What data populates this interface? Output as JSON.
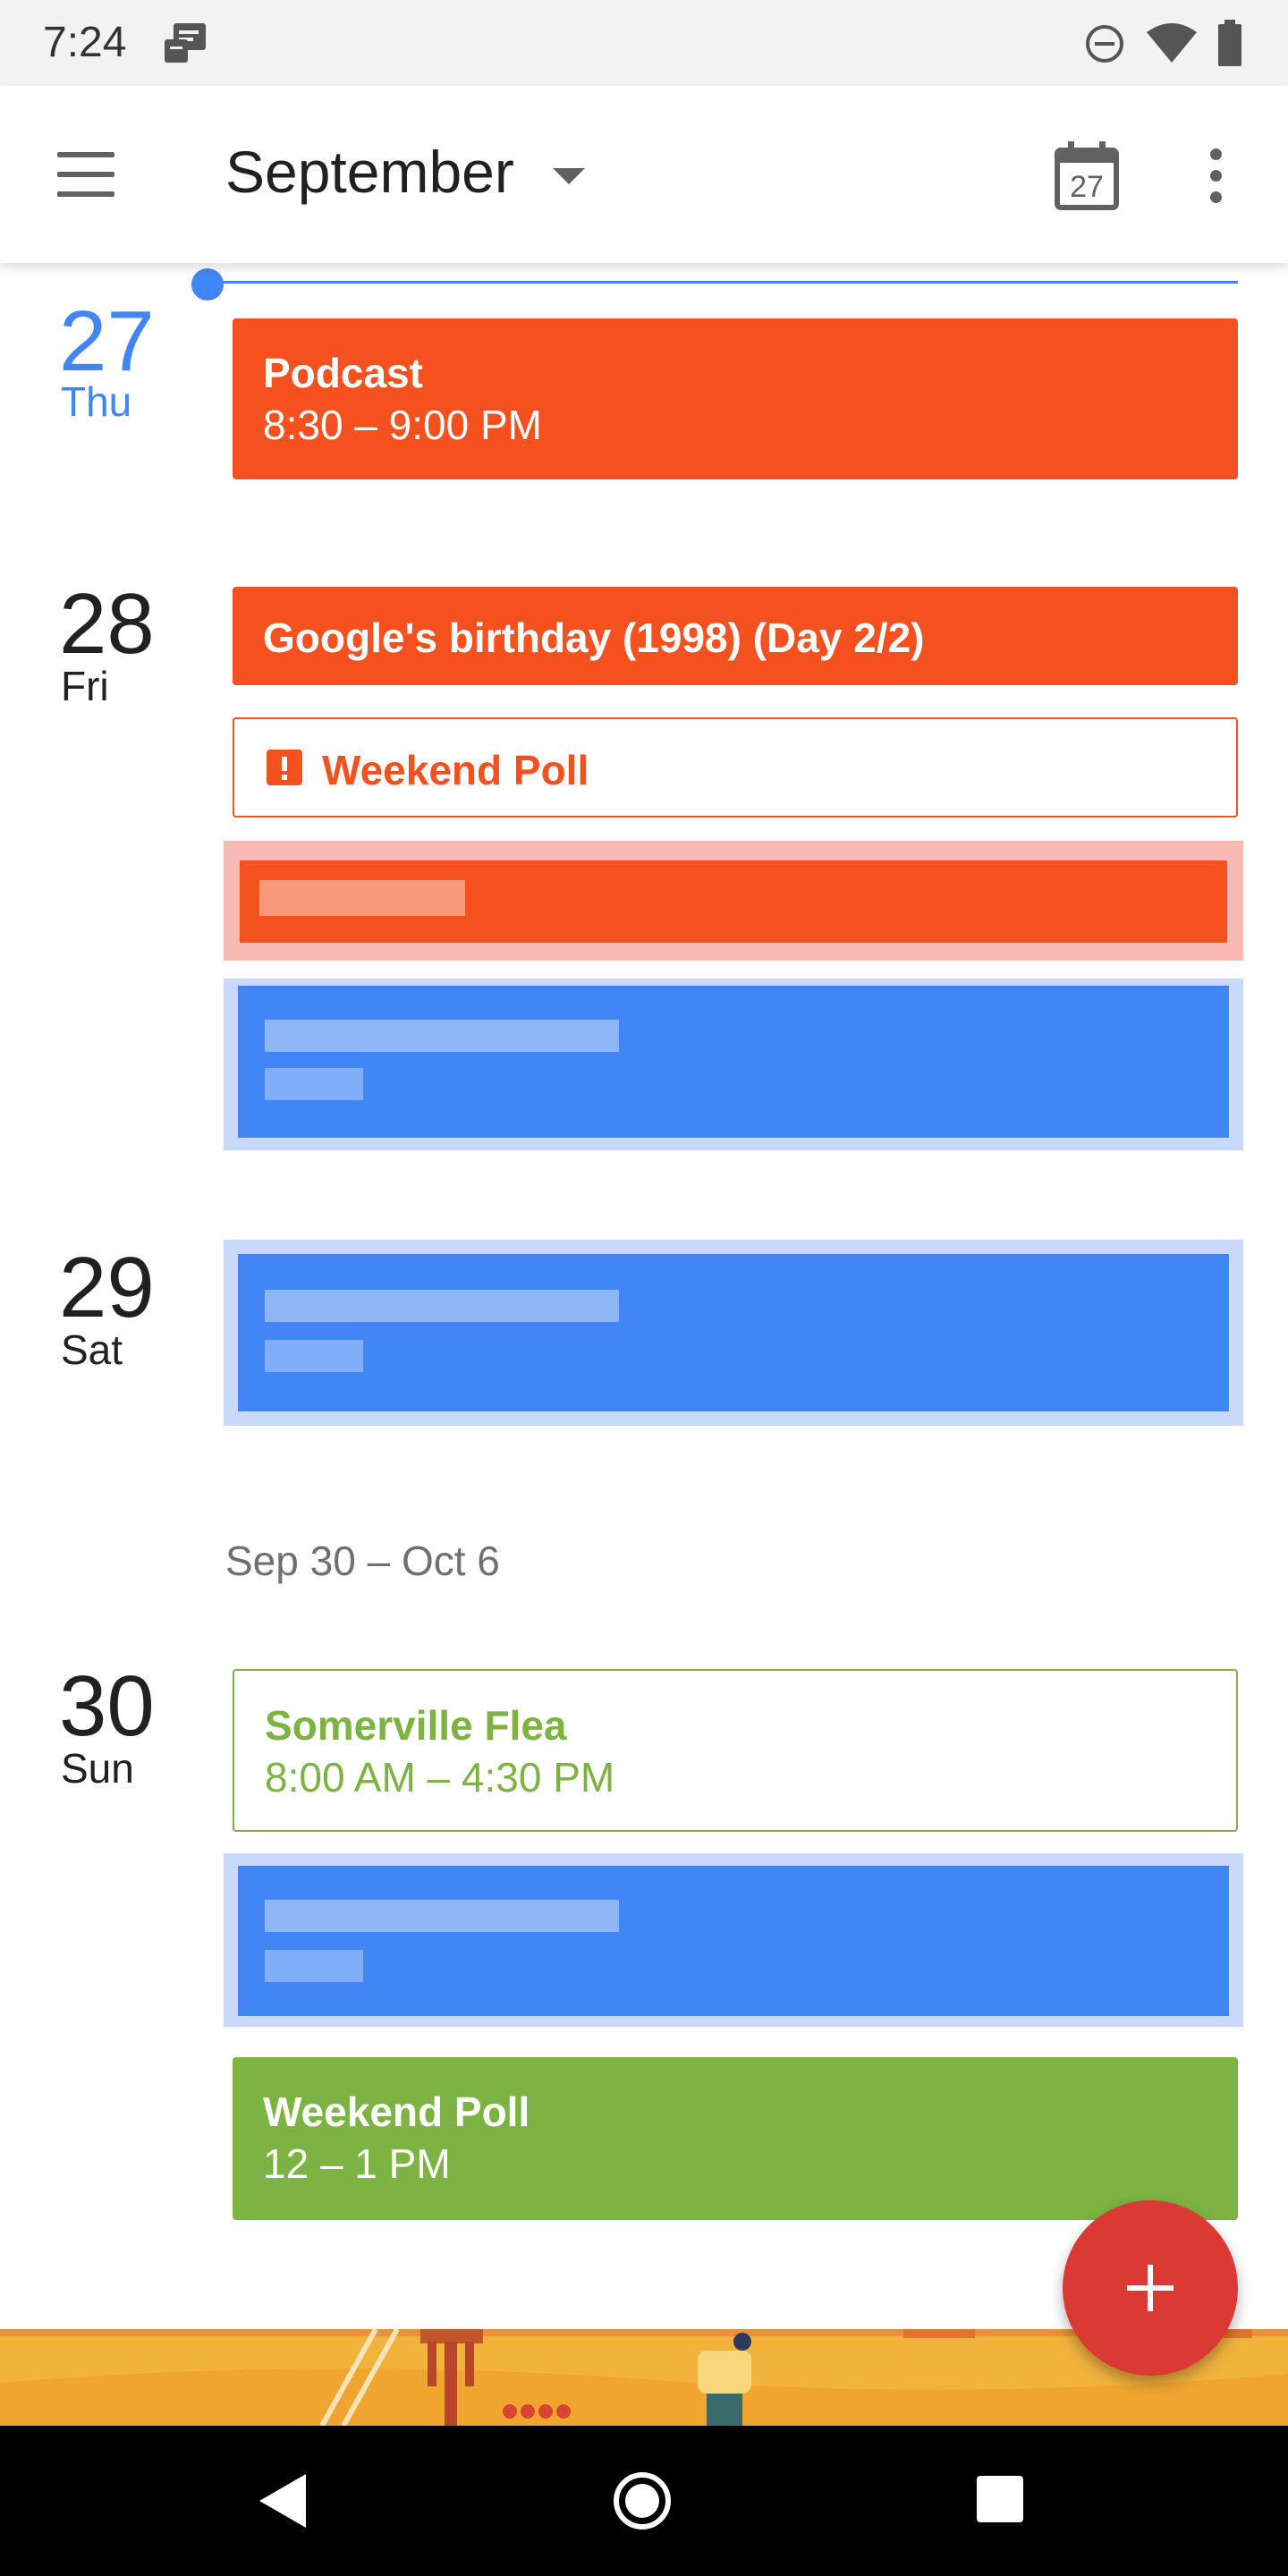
{
  "status_bar": {
    "time": "7:24",
    "icons": [
      "message-notification-icon",
      "do-not-disturb-icon",
      "wifi-icon",
      "battery-icon"
    ]
  },
  "app_bar": {
    "title": "September",
    "today_date": "27",
    "icons": [
      "menu-icon",
      "dropdown-caret-icon",
      "calendar-today-icon",
      "more-vert-icon"
    ]
  },
  "days": [
    {
      "number": "27",
      "name": "Thu",
      "is_today": true,
      "events": [
        {
          "title": "Podcast",
          "time": "8:30 – 9:00 PM",
          "color": "#f4511e",
          "style": "filled"
        }
      ]
    },
    {
      "number": "28",
      "name": "Fri",
      "events": [
        {
          "title": "Google's birthday (1998) (Day 2/2)",
          "color": "#f4511e",
          "style": "filled"
        },
        {
          "title": "Weekend Poll",
          "color": "#f4511e",
          "style": "outlined",
          "icon": "alert-icon"
        },
        {
          "redacted": true,
          "color": "#f4511e"
        },
        {
          "redacted": true,
          "color": "#4285f4"
        }
      ]
    },
    {
      "number": "29",
      "name": "Sat",
      "events": [
        {
          "redacted": true,
          "color": "#4285f4"
        }
      ]
    }
  ],
  "week_header": "Sep 30 – Oct 6",
  "days_next_week": [
    {
      "number": "30",
      "name": "Sun",
      "events": [
        {
          "title": "Somerville Flea",
          "time": "8:00 AM – 4:30 PM",
          "color": "#7cb342",
          "style": "outlined"
        },
        {
          "redacted": true,
          "color": "#4285f4"
        },
        {
          "title": "Weekend Poll",
          "time": "12 – 1 PM",
          "color": "#7cb342",
          "style": "filled"
        }
      ]
    }
  ],
  "fab": {
    "icon": "add-icon"
  },
  "nav_bar": {
    "icons": [
      "back-icon",
      "home-icon",
      "recents-icon"
    ]
  },
  "colors": {
    "accent": "#4285f4",
    "orange": "#f4511e",
    "green": "#7cb342",
    "fab": "#db3a34"
  }
}
